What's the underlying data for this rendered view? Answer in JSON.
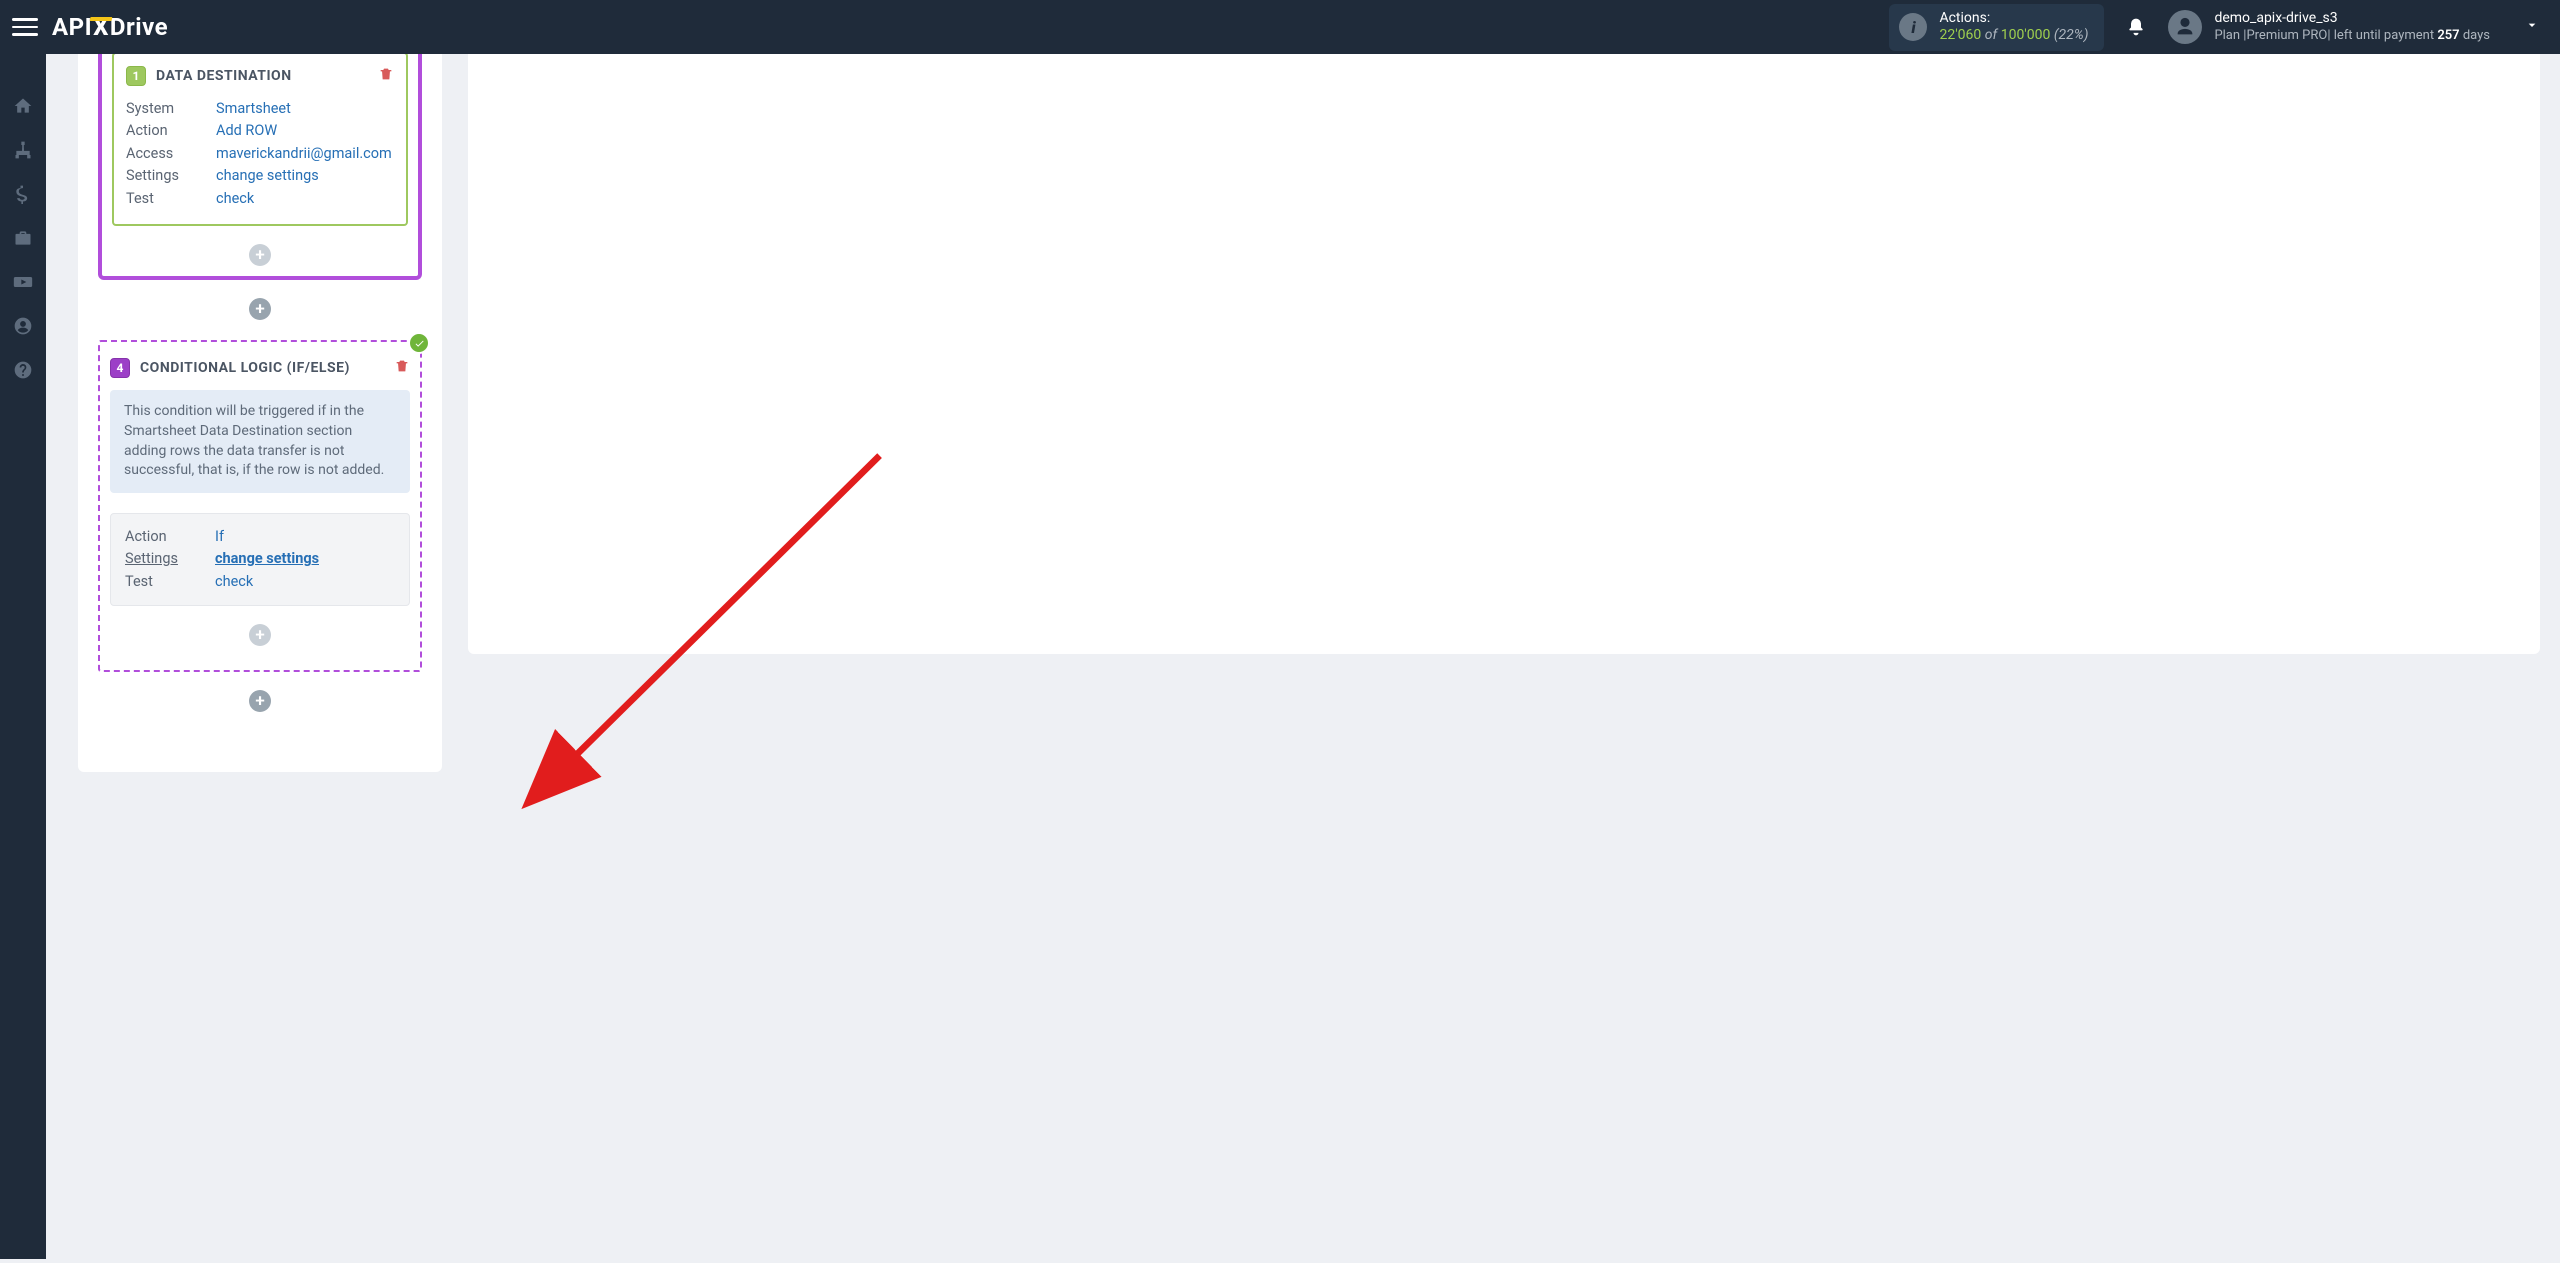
{
  "brand": {
    "part1": "API",
    "part2": "X",
    "part3": "Drive"
  },
  "actions_widget": {
    "label": "Actions:",
    "used": "22'060",
    "of": "of",
    "total": "100'000",
    "percent": "(22%)"
  },
  "user": {
    "name": "demo_apix-drive_s3",
    "plan_prefix": "Plan |Premium PRO| left until payment ",
    "days": "257",
    "days_suffix": " days"
  },
  "dest_block": {
    "num": "1",
    "title": "DATA DESTINATION",
    "rows": {
      "system_k": "System",
      "system_v": "Smartsheet",
      "action_k": "Action",
      "action_v": "Add ROW",
      "access_k": "Access",
      "access_v": "maverickandrii@gmail.com",
      "settings_k": "Settings",
      "settings_v": "change settings",
      "test_k": "Test",
      "test_v": "check"
    }
  },
  "cond_block": {
    "num": "4",
    "title": "CONDITIONAL LOGIC (IF/ELSE)",
    "info": "This condition will be triggered if in the Smartsheet Data Destination section adding rows the data transfer is not successful, that is, if the row is not added.",
    "rows": {
      "action_k": "Action",
      "action_v": "If",
      "settings_k": "Settings",
      "settings_v": "change settings",
      "test_k": "Test",
      "test_v": "check"
    }
  }
}
